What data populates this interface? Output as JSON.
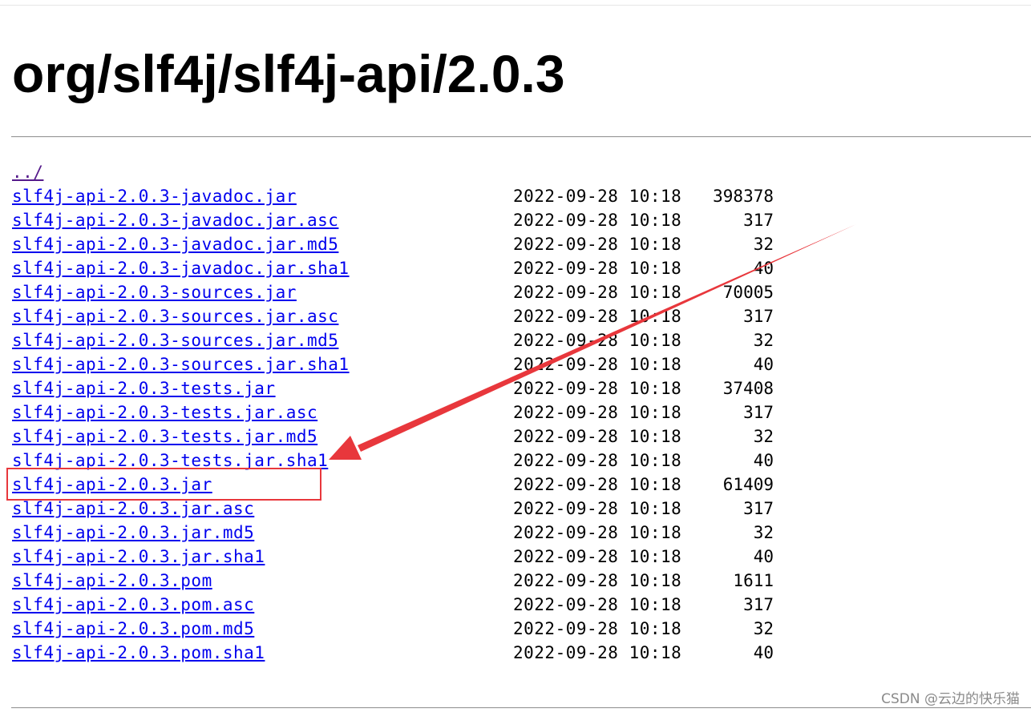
{
  "title": "org/slf4j/slf4j-api/2.0.3",
  "parent_link": "../",
  "files": [
    {
      "name": "slf4j-api-2.0.3-javadoc.jar",
      "date": "2022-09-28 10:18",
      "size": "398378"
    },
    {
      "name": "slf4j-api-2.0.3-javadoc.jar.asc",
      "date": "2022-09-28 10:18",
      "size": "317"
    },
    {
      "name": "slf4j-api-2.0.3-javadoc.jar.md5",
      "date": "2022-09-28 10:18",
      "size": "32"
    },
    {
      "name": "slf4j-api-2.0.3-javadoc.jar.sha1",
      "date": "2022-09-28 10:18",
      "size": "40"
    },
    {
      "name": "slf4j-api-2.0.3-sources.jar",
      "date": "2022-09-28 10:18",
      "size": "70005"
    },
    {
      "name": "slf4j-api-2.0.3-sources.jar.asc",
      "date": "2022-09-28 10:18",
      "size": "317"
    },
    {
      "name": "slf4j-api-2.0.3-sources.jar.md5",
      "date": "2022-09-28 10:18",
      "size": "32"
    },
    {
      "name": "slf4j-api-2.0.3-sources.jar.sha1",
      "date": "2022-09-28 10:18",
      "size": "40"
    },
    {
      "name": "slf4j-api-2.0.3-tests.jar",
      "date": "2022-09-28 10:18",
      "size": "37408"
    },
    {
      "name": "slf4j-api-2.0.3-tests.jar.asc",
      "date": "2022-09-28 10:18",
      "size": "317"
    },
    {
      "name": "slf4j-api-2.0.3-tests.jar.md5",
      "date": "2022-09-28 10:18",
      "size": "32"
    },
    {
      "name": "slf4j-api-2.0.3-tests.jar.sha1",
      "date": "2022-09-28 10:18",
      "size": "40"
    },
    {
      "name": "slf4j-api-2.0.3.jar",
      "date": "2022-09-28 10:18",
      "size": "61409"
    },
    {
      "name": "slf4j-api-2.0.3.jar.asc",
      "date": "2022-09-28 10:18",
      "size": "317"
    },
    {
      "name": "slf4j-api-2.0.3.jar.md5",
      "date": "2022-09-28 10:18",
      "size": "32"
    },
    {
      "name": "slf4j-api-2.0.3.jar.sha1",
      "date": "2022-09-28 10:18",
      "size": "40"
    },
    {
      "name": "slf4j-api-2.0.3.pom",
      "date": "2022-09-28 10:18",
      "size": "1611"
    },
    {
      "name": "slf4j-api-2.0.3.pom.asc",
      "date": "2022-09-28 10:18",
      "size": "317"
    },
    {
      "name": "slf4j-api-2.0.3.pom.md5",
      "date": "2022-09-28 10:18",
      "size": "32"
    },
    {
      "name": "slf4j-api-2.0.3.pom.sha1",
      "date": "2022-09-28 10:18",
      "size": "40"
    }
  ],
  "annotation": {
    "highlighted_file": "slf4j-api-2.0.3.jar",
    "color": "#e8373c",
    "shapes": [
      "highlight-box",
      "arrow"
    ]
  },
  "watermark": "CSDN @云边的快乐猫"
}
